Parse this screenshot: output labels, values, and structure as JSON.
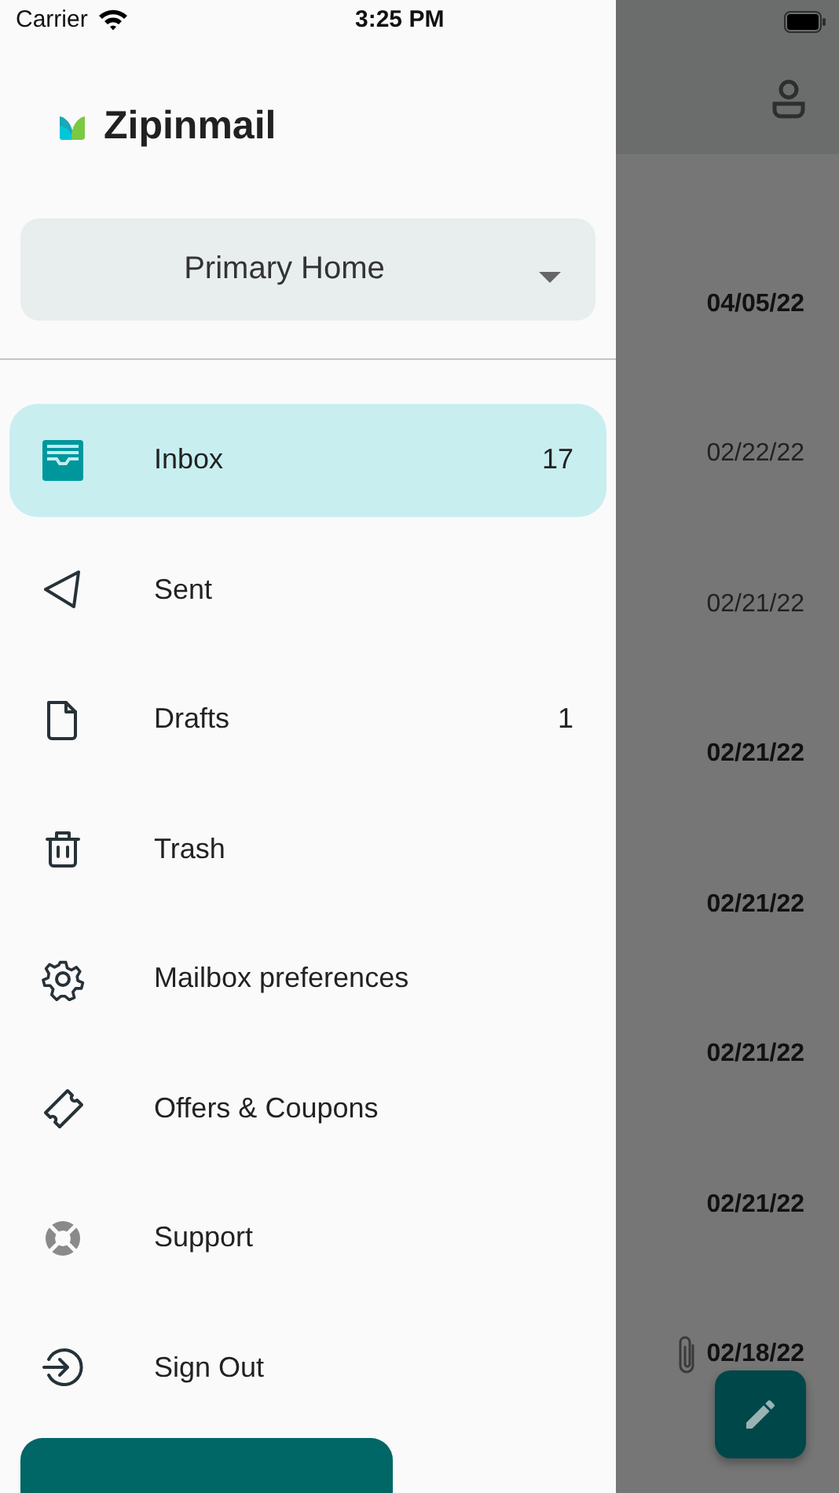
{
  "status_bar": {
    "carrier": "Carrier",
    "time": "3:25 PM"
  },
  "drawer": {
    "app_name": "Zipinmail",
    "account": {
      "value": "Primary Home"
    },
    "items": [
      {
        "kind": "inbox",
        "label": "Inbox",
        "count": "17",
        "selected": true
      },
      {
        "kind": "sent",
        "label": "Sent",
        "selected": false
      },
      {
        "kind": "drafts",
        "label": "Drafts",
        "count": "1",
        "selected": false
      },
      {
        "kind": "trash",
        "label": "Trash",
        "selected": false
      },
      {
        "kind": "settings",
        "label": "Mailbox preferences",
        "selected": false
      },
      {
        "kind": "coupon",
        "label": "Offers & Coupons",
        "selected": false
      },
      {
        "kind": "support",
        "label": "Support",
        "selected": false
      },
      {
        "kind": "signout",
        "label": "Sign Out",
        "selected": false
      }
    ]
  },
  "messages": [
    {
      "date": "04/05/22",
      "unread": true,
      "attachment": false
    },
    {
      "date": "02/22/22",
      "unread": false,
      "attachment": false
    },
    {
      "date": "02/21/22",
      "unread": false,
      "attachment": false
    },
    {
      "date": "02/21/22",
      "unread": true,
      "attachment": false
    },
    {
      "date": "02/21/22",
      "unread": true,
      "attachment": false
    },
    {
      "date": "02/21/22",
      "unread": true,
      "attachment": false
    },
    {
      "date": "02/21/22",
      "unread": true,
      "attachment": false
    },
    {
      "date": "02/18/22",
      "unread": true,
      "attachment": true
    }
  ]
}
